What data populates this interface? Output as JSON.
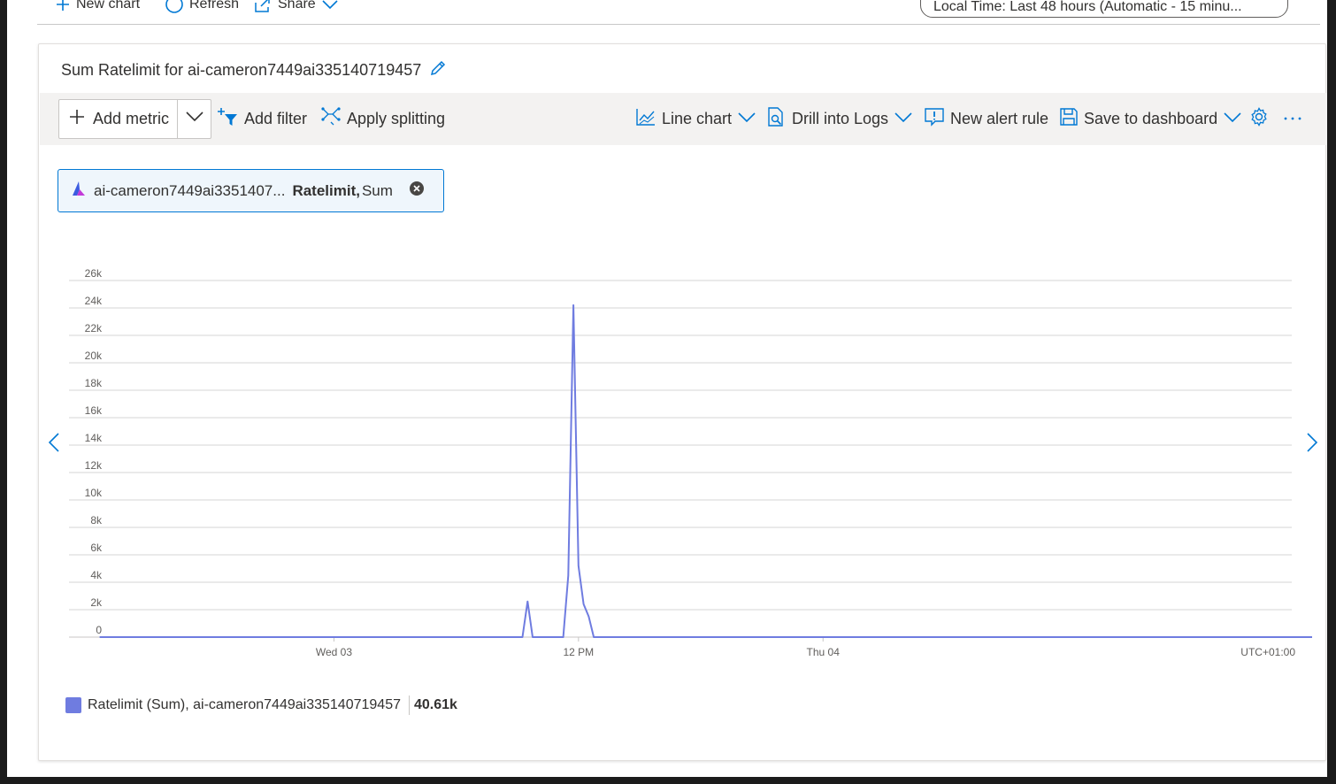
{
  "top_toolbar": {
    "new_chart": "New chart",
    "refresh": "Refresh",
    "share": "Share",
    "time_range": "Local Time: Last 48 hours (Automatic - 15 minu..."
  },
  "card": {
    "title": "Sum Ratelimit for ai-cameron7449ai335140719457",
    "commands": {
      "add_metric": "Add metric",
      "add_filter": "Add filter",
      "apply_splitting": "Apply splitting",
      "line_chart": "Line chart",
      "drill_into_logs": "Drill into Logs",
      "new_alert_rule": "New alert rule",
      "save_to_dashboard": "Save to dashboard"
    },
    "metric_pill": {
      "resource": "ai-cameron7449ai3351407...",
      "metric": "Ratelimit,",
      "aggregation": "Sum"
    },
    "legend": {
      "label": "Ratelimit (Sum), ai-cameron7449ai335140719457",
      "value": "40.61k"
    }
  },
  "colors": {
    "series": "#6f7ce0",
    "accent": "#0078d4",
    "gridline": "#d6d6d6"
  },
  "icons": [
    "plus-icon",
    "refresh-icon",
    "share-icon",
    "chevron-down-icon",
    "pencil-icon",
    "filter-icon",
    "splitting-icon",
    "line-chart-icon",
    "logs-icon",
    "alert-icon",
    "save-icon",
    "gear-icon",
    "more-icon",
    "close-circle-icon",
    "chevron-left-icon",
    "chevron-right-icon",
    "resource-icon"
  ],
  "chart_data": {
    "type": "line",
    "ylim": [
      0,
      26000
    ],
    "y_ticks": [
      {
        "value": 0,
        "label": "0"
      },
      {
        "value": 2000,
        "label": "2k"
      },
      {
        "value": 4000,
        "label": "4k"
      },
      {
        "value": 6000,
        "label": "6k"
      },
      {
        "value": 8000,
        "label": "8k"
      },
      {
        "value": 10000,
        "label": "10k"
      },
      {
        "value": 12000,
        "label": "12k"
      },
      {
        "value": 14000,
        "label": "14k"
      },
      {
        "value": 16000,
        "label": "16k"
      },
      {
        "value": 18000,
        "label": "18k"
      },
      {
        "value": 20000,
        "label": "20k"
      },
      {
        "value": 22000,
        "label": "22k"
      },
      {
        "value": 24000,
        "label": "24k"
      },
      {
        "value": 26000,
        "label": "26k"
      }
    ],
    "x_unit": "hours",
    "xlim": [
      -13,
      47
    ],
    "x_ticks": [
      {
        "value": 0,
        "label": "Wed 03"
      },
      {
        "value": 12,
        "label": "12 PM"
      },
      {
        "value": 24,
        "label": "Thu 04"
      }
    ],
    "timezone_label": "UTC+01:00",
    "grid": true,
    "series": [
      {
        "name": "Ratelimit (Sum), ai-cameron7449ai335140719457",
        "points": [
          [
            -11.5,
            0
          ],
          [
            9.25,
            0
          ],
          [
            9.5,
            2600
          ],
          [
            9.75,
            0
          ],
          [
            11.25,
            0
          ],
          [
            11.5,
            4500
          ],
          [
            11.75,
            24200
          ],
          [
            12.0,
            5200
          ],
          [
            12.25,
            2400
          ],
          [
            12.5,
            1500
          ],
          [
            12.75,
            0
          ],
          [
            48.0,
            0
          ]
        ]
      }
    ]
  }
}
